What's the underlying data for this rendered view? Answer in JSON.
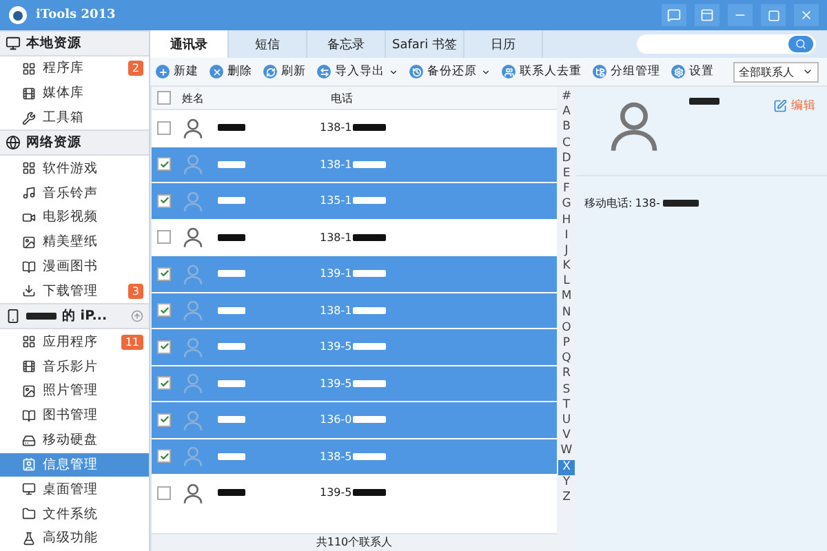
{
  "window": {
    "title": "iTools 2013"
  },
  "sidebar": {
    "sections": [
      {
        "kind": "local",
        "label": "本地资源",
        "items": [
          {
            "label": "程序库",
            "badge": "2",
            "selected": false
          },
          {
            "label": "媒体库",
            "selected": false
          },
          {
            "label": "工具箱",
            "selected": false
          }
        ]
      },
      {
        "kind": "web",
        "label": "网络资源",
        "items": [
          {
            "label": "软件游戏",
            "selected": false
          },
          {
            "label": "音乐铃声",
            "selected": false
          },
          {
            "label": "电影视频",
            "selected": false
          },
          {
            "label": "精美壁纸",
            "selected": false
          },
          {
            "label": "漫画图书",
            "selected": false
          },
          {
            "label": "下载管理",
            "badge": "3",
            "selected": false
          }
        ]
      },
      {
        "kind": "device",
        "label": "的 iP...",
        "items": [
          {
            "label": "应用程序",
            "badge": "11",
            "selected": false
          },
          {
            "label": "音乐影片",
            "selected": false
          },
          {
            "label": "照片管理",
            "selected": false
          },
          {
            "label": "图书管理",
            "selected": false
          },
          {
            "label": "移动硬盘",
            "selected": false
          },
          {
            "label": "信息管理",
            "selected": true
          },
          {
            "label": "桌面管理",
            "selected": false
          },
          {
            "label": "文件系统",
            "selected": false
          },
          {
            "label": "高级功能",
            "selected": false
          }
        ]
      }
    ]
  },
  "tabs": [
    {
      "label": "通讯录",
      "selected": true
    },
    {
      "label": "短信",
      "selected": false
    },
    {
      "label": "备忘录",
      "selected": false
    },
    {
      "label": "Safari 书签",
      "selected": false
    },
    {
      "label": "日历",
      "selected": false
    }
  ],
  "toolbar": [
    {
      "label": "新建",
      "dropdown": false
    },
    {
      "label": "删除",
      "dropdown": false
    },
    {
      "label": "刷新",
      "dropdown": false
    },
    {
      "label": "导入导出",
      "dropdown": true
    },
    {
      "label": "备份还原",
      "dropdown": true
    },
    {
      "label": "联系人去重",
      "dropdown": false
    },
    {
      "label": "分组管理",
      "dropdown": false
    },
    {
      "label": "设置",
      "dropdown": false
    }
  ],
  "filter": {
    "value": "全部联系人"
  },
  "table": {
    "all_checked": false,
    "columns": [
      "姓名",
      "电话"
    ],
    "rows": [
      {
        "phone": "138-1",
        "checked": false
      },
      {
        "phone": "138-1",
        "checked": true
      },
      {
        "phone": "135-1",
        "checked": true
      },
      {
        "phone": "138-1",
        "checked": false
      },
      {
        "phone": "139-1",
        "checked": true
      },
      {
        "phone": "138-1",
        "checked": true
      },
      {
        "phone": "139-5",
        "checked": true
      },
      {
        "phone": "139-5",
        "checked": true
      },
      {
        "phone": "136-0",
        "checked": true
      },
      {
        "phone": "138-5",
        "checked": true
      },
      {
        "phone": "139-5",
        "checked": false
      }
    ]
  },
  "index": [
    {
      "label": "#",
      "selected": false
    },
    {
      "label": "A",
      "selected": false
    },
    {
      "label": "B",
      "selected": false
    },
    {
      "label": "C",
      "selected": false
    },
    {
      "label": "D",
      "selected": false
    },
    {
      "label": "E",
      "selected": false
    },
    {
      "label": "F",
      "selected": false
    },
    {
      "label": "G",
      "selected": false
    },
    {
      "label": "H",
      "selected": false
    },
    {
      "label": "I",
      "selected": false
    },
    {
      "label": "J",
      "selected": false
    },
    {
      "label": "K",
      "selected": false
    },
    {
      "label": "L",
      "selected": false
    },
    {
      "label": "M",
      "selected": false
    },
    {
      "label": "N",
      "selected": false
    },
    {
      "label": "O",
      "selected": false
    },
    {
      "label": "P",
      "selected": false
    },
    {
      "label": "Q",
      "selected": false
    },
    {
      "label": "R",
      "selected": false
    },
    {
      "label": "S",
      "selected": false
    },
    {
      "label": "T",
      "selected": false
    },
    {
      "label": "U",
      "selected": false
    },
    {
      "label": "V",
      "selected": false
    },
    {
      "label": "W",
      "selected": false
    },
    {
      "label": "X",
      "selected": true
    },
    {
      "label": "Y",
      "selected": false
    },
    {
      "label": "Z",
      "selected": false
    }
  ],
  "status_bar": "共110个联系人",
  "detail": {
    "edit": "编辑",
    "field_label": "移动电话:",
    "phone": "138-"
  }
}
